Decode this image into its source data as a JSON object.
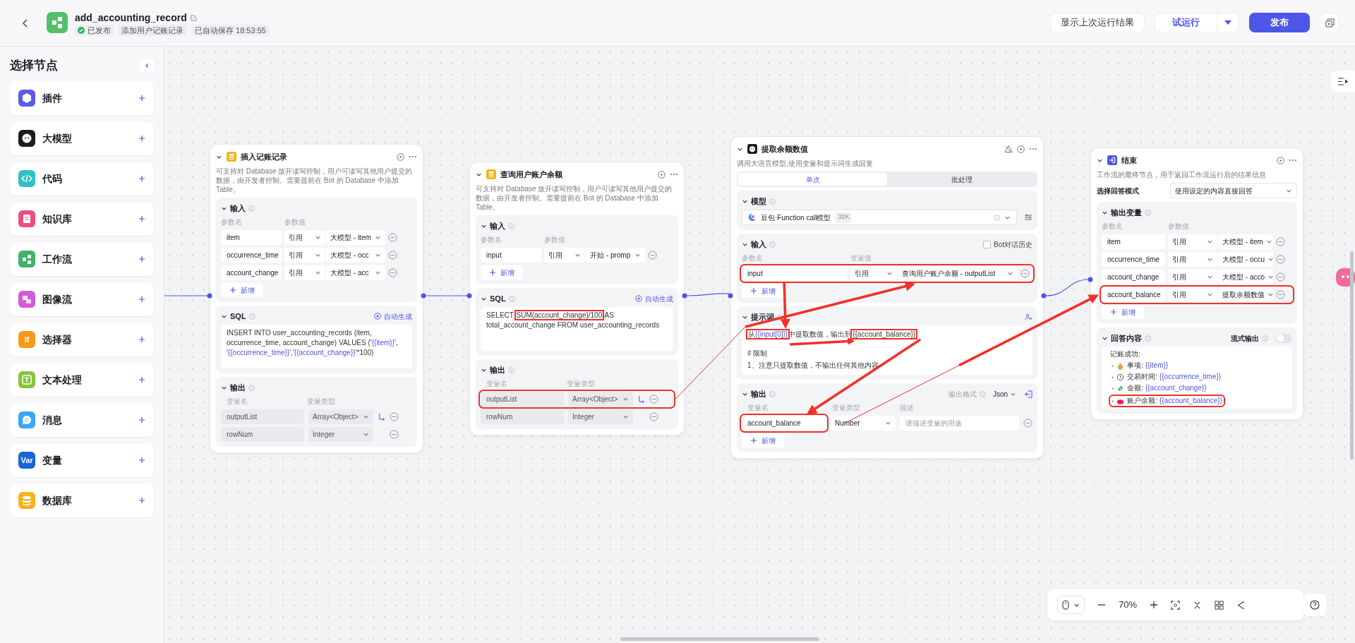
{
  "header": {
    "title": "add_accounting_record",
    "status": "已发布",
    "description": "添加用户记账记录",
    "autosave": "已自动保存 18:53:55"
  },
  "actions": {
    "show_last_result": "显示上次运行结果",
    "test_run": "试运行",
    "publish": "发布"
  },
  "sidebar": {
    "title": "选择节点",
    "items": [
      {
        "label": "插件",
        "kind": "plugin",
        "color": "#5a5be8"
      },
      {
        "label": "大模型",
        "kind": "llm",
        "color": "#1c1c1e"
      },
      {
        "label": "代码",
        "kind": "code",
        "color": "#2fc0c5"
      },
      {
        "label": "知识库",
        "kind": "knowledge",
        "color": "#ea4f7c"
      },
      {
        "label": "工作流",
        "kind": "workflow",
        "color": "#3fb36a"
      },
      {
        "label": "图像流",
        "kind": "imageflow",
        "color": "#d35ad8"
      },
      {
        "label": "选择器",
        "kind": "text_tile",
        "icon_text": "If",
        "color": "#f59a1b"
      },
      {
        "label": "文本处理",
        "kind": "text",
        "color": "#86c43a"
      },
      {
        "label": "消息",
        "kind": "message",
        "color": "#3aa6f5"
      },
      {
        "label": "变量",
        "kind": "text_tile",
        "icon_text": "Var",
        "color": "#1664d9"
      },
      {
        "label": "数据库",
        "kind": "database",
        "color": "#f6b21e"
      }
    ]
  },
  "nodes": [
    {
      "kind": "database",
      "title": "插入记账记录",
      "description": "可支持对 Database 放开读写控制，用户可读写其他用户提交的数据，由开发者控制。需要提前在 Bot 的 Database 中添加 Table。",
      "inputs": {
        "title": "输入",
        "name_header": "参数名",
        "value_header": "参数值",
        "add_label": "新增",
        "rows": [
          {
            "name": "item",
            "mode": "引用",
            "value": "大模型 - item",
            "highlighted": false
          },
          {
            "name": "occurrence_time",
            "mode": "引用",
            "value": "大模型 - occ",
            "highlighted": false
          },
          {
            "name": "account_change",
            "mode": "引用",
            "value": "大模型 - acc",
            "highlighted": false
          }
        ]
      },
      "sql": {
        "title": "SQL",
        "auto_label": "自动生成",
        "segments": [
          {
            "text": "INSERT INTO user_accounting_records (item, occurrence_time, account_change) VALUES ('"
          },
          {
            "text": "{{item}}",
            "var": true
          },
          {
            "text": "', '"
          },
          {
            "text": "{{occurrence_time}}",
            "var": true
          },
          {
            "text": "','"
          },
          {
            "text": "{{account_change}}",
            "var": true
          },
          {
            "text": "'*100)"
          }
        ]
      },
      "outputs": {
        "title": "输出",
        "name_header": "变量名",
        "type_header": "变量类型",
        "rows": [
          {
            "name": "outputList",
            "type": "Array<Object>",
            "highlighted": false
          },
          {
            "name": "rowNum",
            "type": "Integer",
            "highlighted": false
          }
        ]
      }
    },
    {
      "kind": "database",
      "title": "查询用户账户余额",
      "description": "可支持对 Database 放开读写控制，用户可读写其他用户提交的数据，由开发者控制。需要提前在 Bot 的 Database 中添加 Table。",
      "inputs": {
        "title": "输入",
        "name_header": "参数名",
        "value_header": "参数值",
        "add_label": "新增",
        "rows": [
          {
            "name": "input",
            "mode": "引用",
            "value": "开始 - promp",
            "highlighted": false
          }
        ]
      },
      "sql": {
        "title": "SQL",
        "auto_label": "自动生成",
        "segments": [
          {
            "text": "SELECT "
          },
          {
            "text": "SUM(account_change)/100",
            "highlighted": true
          },
          {
            "text": " AS total_account_change FROM user_accounting_records"
          }
        ]
      },
      "outputs": {
        "title": "输出",
        "name_header": "变量名",
        "type_header": "变量类型",
        "rows": [
          {
            "name": "outputList",
            "type": "Array<Object>",
            "highlighted": true
          },
          {
            "name": "rowNum",
            "type": "Integer",
            "highlighted": false
          }
        ]
      }
    },
    {
      "kind": "llm",
      "title": "提取余额数值",
      "description": "调用大语言模型,使用变量和提示词生成回复",
      "tabs": [
        {
          "label": "单次",
          "selected": true
        },
        {
          "label": "批处理",
          "selected": false
        }
      ],
      "model": {
        "title": "模型",
        "name": "豆包·Function call模型",
        "badge": "32K"
      },
      "inputs": {
        "title": "输入",
        "history_label": "Bot对话历史",
        "history_checked": false,
        "name_header": "参数名",
        "value_header": "变量值",
        "add_label": "新增",
        "rows": [
          {
            "name": "input",
            "mode": "引用",
            "value": "查询用户账户余额 - outputList",
            "highlighted": true
          }
        ]
      },
      "prompt": {
        "title": "提示词",
        "lines": [
          [
            {
              "highlighted": true,
              "segments": [
                {
                  "text": "从"
                },
                {
                  "text": "{{input[0]}}",
                  "var": true
                }
              ]
            },
            {
              "text": "中提取数值，输出到"
            },
            {
              "text": "{{account_balance}}",
              "highlighted": true
            }
          ],
          [
            {
              "text": "# 限制"
            }
          ],
          [
            {
              "text": "1、注意只提取数值，不输出任何其他内容"
            }
          ]
        ]
      },
      "outputs": {
        "title": "输出",
        "format_label": "输出格式",
        "format": "Json",
        "name_header": "变量名",
        "type_header": "变量类型",
        "desc_header": "描述",
        "add_label": "新增",
        "rows": [
          {
            "name": "account_balance",
            "type": "Number",
            "placeholder": "请描述变量的用途",
            "highlighted": true
          }
        ]
      }
    },
    {
      "kind": "end",
      "title": "结束",
      "description": "工作流的最终节点，用于返回工作流运行后的结果信息",
      "mode_label": "选择回答模式",
      "mode": "使用设定的内容直接回答",
      "inputs": {
        "title": "输出变量",
        "name_header": "参数名",
        "value_header": "参数值",
        "add_label": "新增",
        "rows": [
          {
            "name": "item",
            "mode": "引用",
            "value": "大模型 - item",
            "highlighted": false
          },
          {
            "name": "occurrence_time",
            "mode": "引用",
            "value": "大模型 - occu",
            "highlighted": false
          },
          {
            "name": "account_change",
            "mode": "引用",
            "value": "大模型 - acco",
            "highlighted": false
          },
          {
            "name": "account_balance",
            "mode": "引用",
            "value": "提取余额数值",
            "highlighted": true
          }
        ]
      },
      "answer": {
        "title": "回答内容",
        "stream_label": "流式输出",
        "stream": false,
        "lines": [
          {
            "kind": "heading",
            "text": "记账成功:"
          },
          {
            "kind": "item",
            "bullet": "-",
            "label": "事项:",
            "var": "{{item}}",
            "highlighted": false
          },
          {
            "kind": "item",
            "bullet": "-",
            "label": "交易时间:",
            "var": "{{occurrence_time}}",
            "highlighted": false
          },
          {
            "kind": "item",
            "bullet": "-",
            "label": "金额:",
            "var": "{{account_change}}",
            "highlighted": false
          },
          {
            "kind": "item",
            "bullet": "-",
            "label": "账户余额:",
            "var": "{{account_balance}}",
            "highlighted": true
          }
        ]
      }
    }
  ],
  "zoom": {
    "level": "70%"
  }
}
